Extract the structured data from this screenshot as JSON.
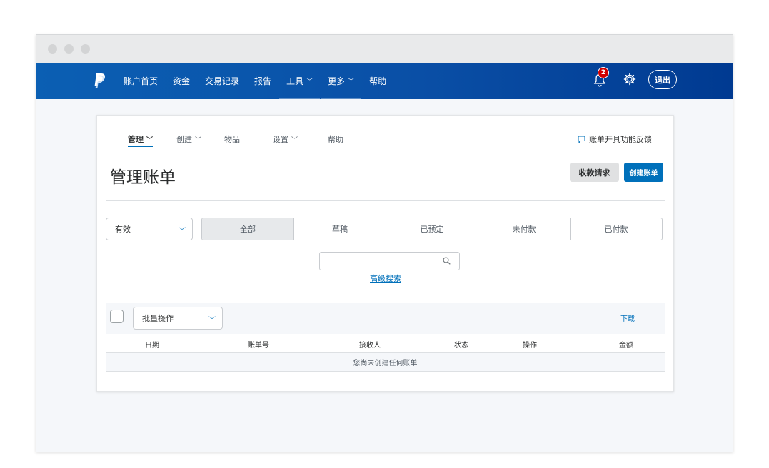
{
  "window": {
    "dots": [
      "close",
      "minimize",
      "maximize"
    ]
  },
  "navbar": {
    "logo_icon": "paypal-logo",
    "links": [
      {
        "label": "账户首页"
      },
      {
        "label": "资金"
      },
      {
        "label": "交易记录"
      },
      {
        "label": "报告"
      },
      {
        "label": "工具",
        "chevron": "﹀"
      },
      {
        "label": "更多",
        "chevron": "﹀"
      },
      {
        "label": "帮助"
      }
    ],
    "notification_count": "2",
    "logout_label": "退出"
  },
  "subnav": {
    "tabs": [
      {
        "label": "管理",
        "chevron": "﹀"
      },
      {
        "label": "创建",
        "chevron": "﹀"
      },
      {
        "label": "物品"
      },
      {
        "label": "设置",
        "chevron": "﹀"
      },
      {
        "label": "帮助"
      }
    ],
    "active_tab": "管理",
    "feedback_label": "账单开具功能反馈"
  },
  "page": {
    "title": "管理账单",
    "request_button": "收款请求",
    "create_button": "创建账单"
  },
  "filters": {
    "status_select": {
      "value": "有效",
      "chevron": "﹀"
    },
    "segments": [
      "全部",
      "草稿",
      "已预定",
      "未付款",
      "已付款"
    ],
    "active_segment": "全部",
    "search_placeholder": "",
    "advanced_search": "高级搜索"
  },
  "table": {
    "bulk_select": {
      "value": "批量操作",
      "chevron": "﹀"
    },
    "download_label": "下载",
    "columns": [
      "日期",
      "账单号",
      "接收人",
      "状态",
      "操作",
      "金额"
    ],
    "empty_message": "您尚未创建任何账单"
  },
  "colors": {
    "accent": "#0070ba",
    "nav_start": "#0b5fb3",
    "nav_end": "#003a91",
    "badge": "#d20000"
  }
}
